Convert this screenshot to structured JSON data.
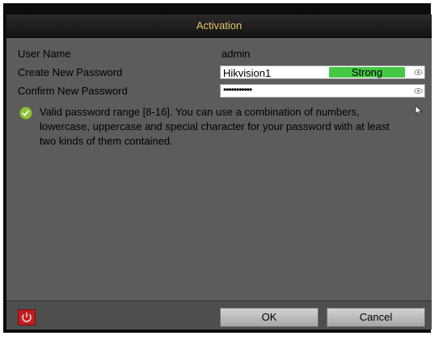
{
  "dialog": {
    "title": "Activation"
  },
  "form": {
    "user_name_label": "User Name",
    "user_name_value": "admin",
    "create_password_label": "Create New Password",
    "create_password_value": "Hikvision1",
    "strength_label": "Strong",
    "confirm_password_label": "Confirm New Password",
    "confirm_password_mask": "•••••••••••"
  },
  "tip": {
    "text": "Valid password range [8-16]. You can use a combination of numbers, lowercase, uppercase and special character for your password with at least two kinds of them contained."
  },
  "footer": {
    "ok_label": "OK",
    "cancel_label": "Cancel"
  },
  "icons": {
    "visibility": "eye-icon",
    "valid": "checkmark-icon",
    "shutdown": "power-icon",
    "pointer": "mouse-cursor-icon"
  },
  "colors": {
    "title_text": "#e6c66a",
    "strength_strong": "#45c845",
    "power_button": "#c21e1e",
    "check_icon": "#8fc23a"
  }
}
